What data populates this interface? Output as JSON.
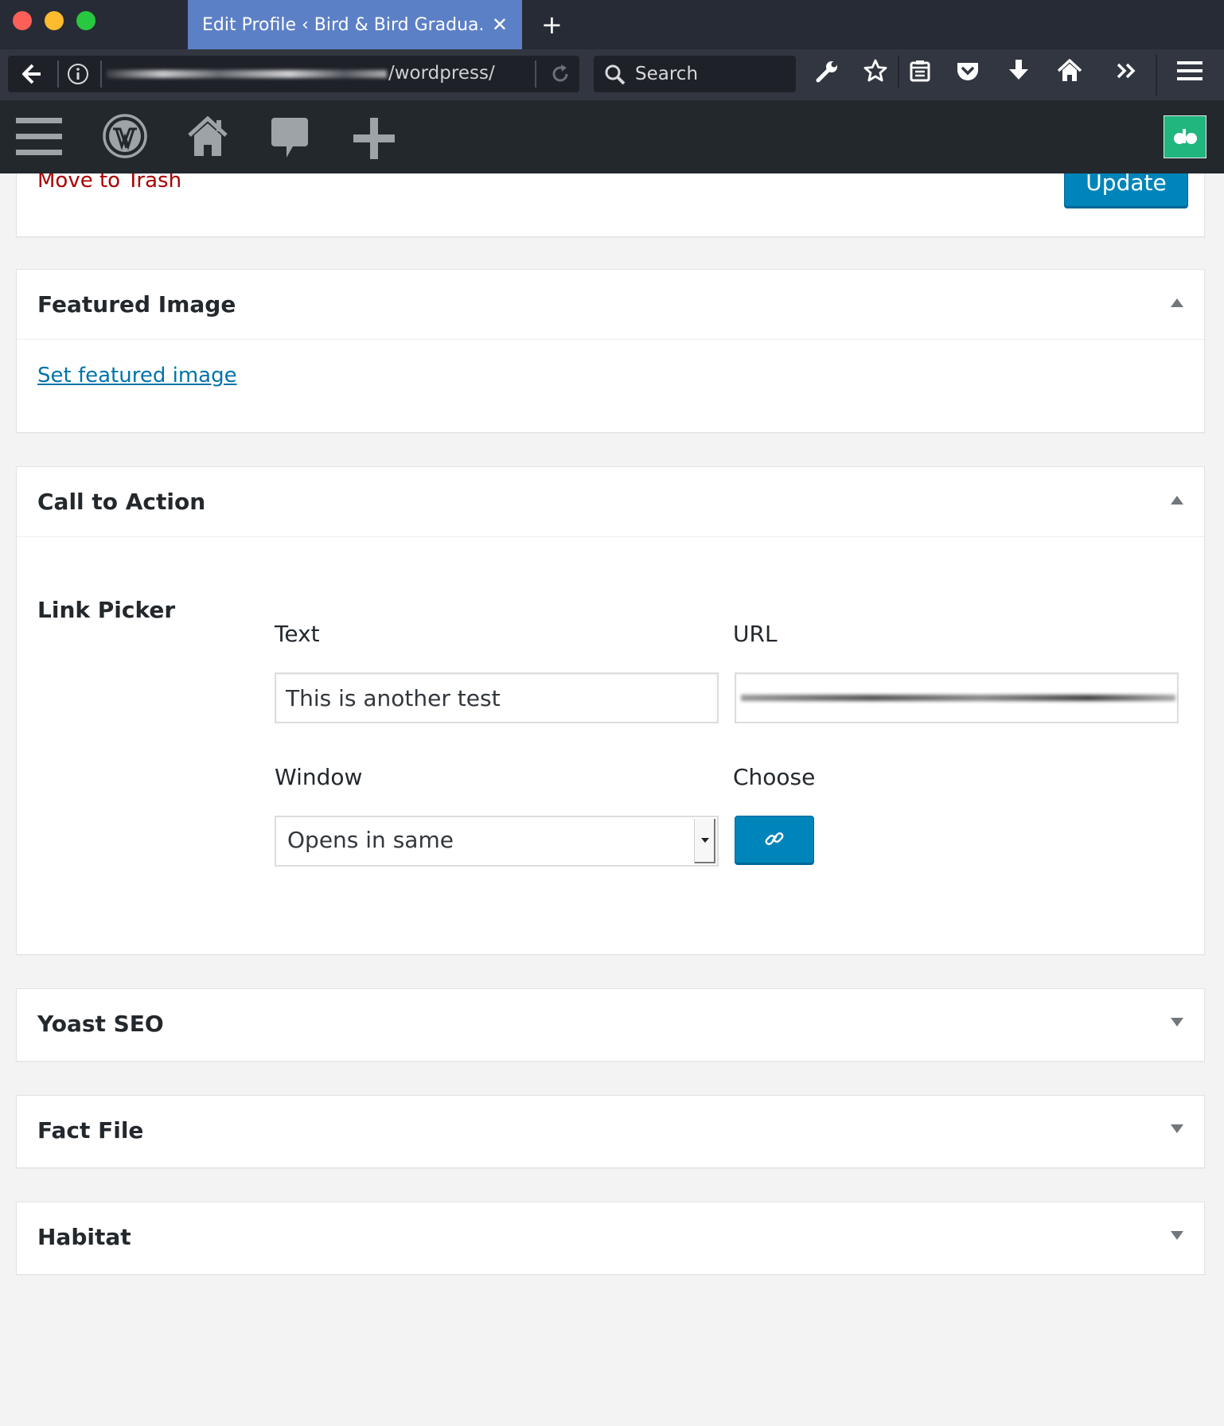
{
  "browser": {
    "tab_title": "Edit Profile ‹ Bird & Bird Gradua...",
    "tab_close": "✕",
    "new_tab": "+",
    "url_suffix": "/wordpress/",
    "search_placeholder": "Search"
  },
  "admin_bar": {
    "icons": [
      "menu-icon",
      "wordpress-logo-icon",
      "home-icon",
      "comments-icon",
      "add-new-icon"
    ],
    "avatar_color": "#21b67e"
  },
  "publish": {
    "trash_label": "Move to Trash",
    "update_label": "Update"
  },
  "featured_image": {
    "title": "Featured Image",
    "link_label": "Set featured image"
  },
  "call_to_action": {
    "title": "Call to Action",
    "link_picker_label": "Link Picker",
    "text_label": "Text",
    "text_value": "This is another test",
    "url_label": "URL",
    "window_label": "Window",
    "window_value": "Opens in same",
    "choose_label": "Choose"
  },
  "collapsed_boxes": {
    "yoast": "Yoast SEO",
    "fact_file": "Fact File",
    "habitat": "Habitat"
  },
  "colors": {
    "primary_button": "#0085ba",
    "trash_link": "#aa0000",
    "link": "#0073aa",
    "admin_bar": "#23282d"
  }
}
